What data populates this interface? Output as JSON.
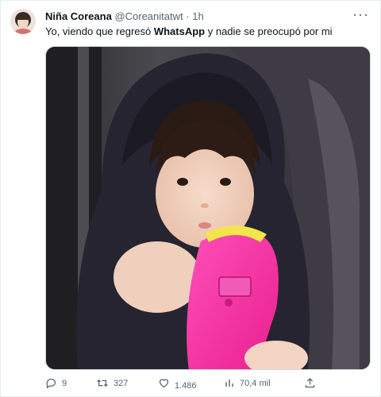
{
  "tweet": {
    "display_name": "Niña Coreana",
    "handle": "@Coreanitatwt",
    "separator": "·",
    "time": "1h",
    "text_before": "Yo, viendo que regresó ",
    "text_bold": "WhatsApp",
    "text_after": " y nadie se preocupó por mi"
  },
  "actions": {
    "replies": "9",
    "retweets": "327",
    "likes": "1.486",
    "views": "70,4 mil"
  },
  "icons": {
    "reply": "reply-bubble-icon",
    "retweet": "retweet-arrows-icon",
    "like": "heart-icon",
    "views": "bar-chart-icon",
    "share": "share-upload-icon",
    "more": "more-dots-icon"
  },
  "colors": {
    "text": "#0f1419",
    "muted": "#536471",
    "border": "#cfd9de"
  }
}
